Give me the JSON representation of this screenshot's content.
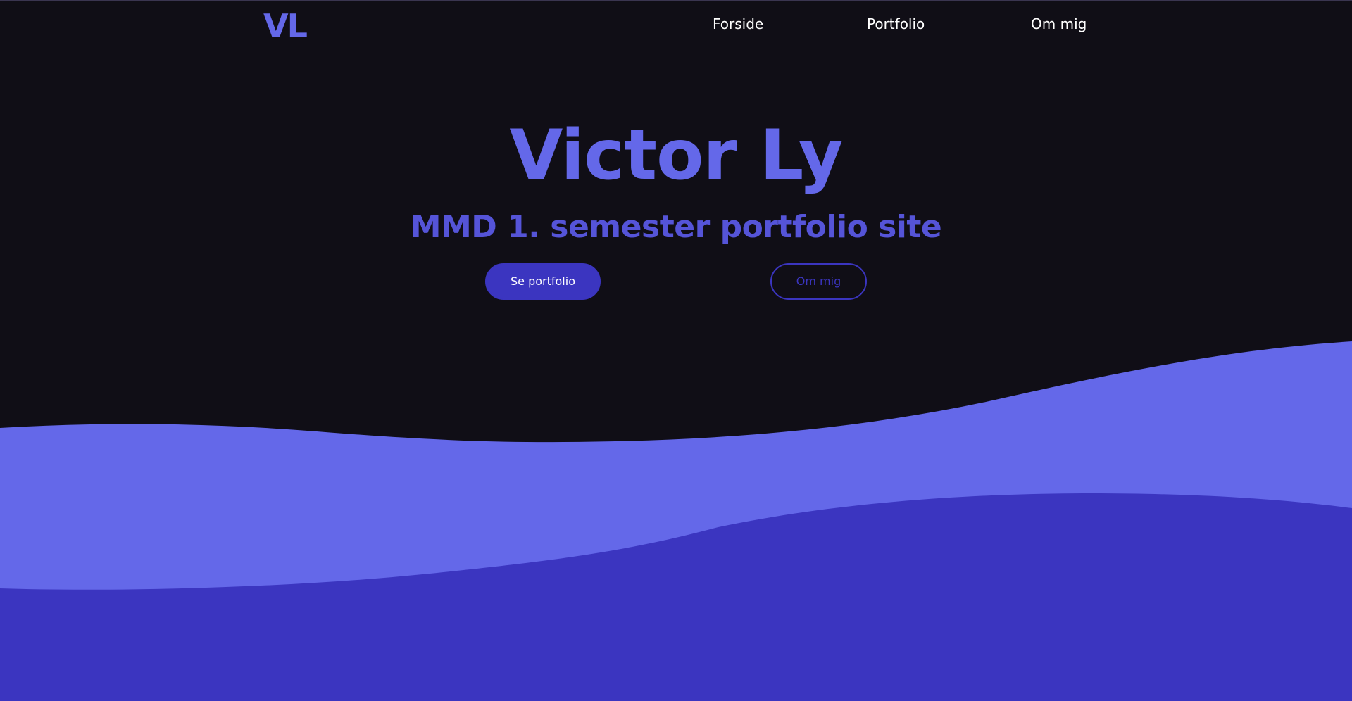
{
  "header": {
    "logo": "VL",
    "nav": [
      {
        "label": "Forside"
      },
      {
        "label": "Portfolio"
      },
      {
        "label": "Om mig"
      }
    ]
  },
  "hero": {
    "title": "Victor Ly",
    "subtitle": "MMD 1. semester portfolio site",
    "primary_button": "Se portfolio",
    "secondary_button": "Om mig"
  },
  "colors": {
    "background": "#100e16",
    "accent_light": "#6468e9",
    "accent_dark": "#3b35c0",
    "nav_text": "#ffffff"
  }
}
